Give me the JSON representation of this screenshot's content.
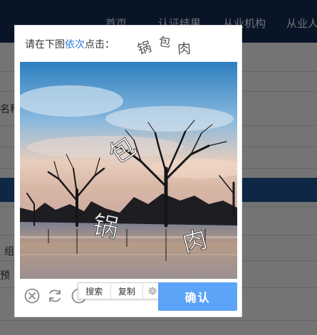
{
  "background": {
    "nav_items": [
      "首页",
      "认证结果",
      "从业机构",
      "从业人"
    ],
    "side_labels": [
      "名称",
      "组",
      "预"
    ]
  },
  "captcha": {
    "prompt_prefix": "请在下图",
    "prompt_accent": "依次",
    "prompt_suffix": "点击：",
    "targets": [
      "锅",
      "包",
      "肉"
    ],
    "scene_chars": [
      "包",
      "锅",
      "肉"
    ],
    "controls": {
      "close": "close-icon",
      "refresh": "refresh-icon",
      "info": "info-icon"
    },
    "context_menu": {
      "search": "搜索",
      "copy": "复制",
      "settings": "gear-icon"
    },
    "confirm_label": "确认",
    "colors": {
      "accent": "#2f7ad8",
      "confirm": "#5ca4f7",
      "nav": "#0e2a4e"
    }
  }
}
